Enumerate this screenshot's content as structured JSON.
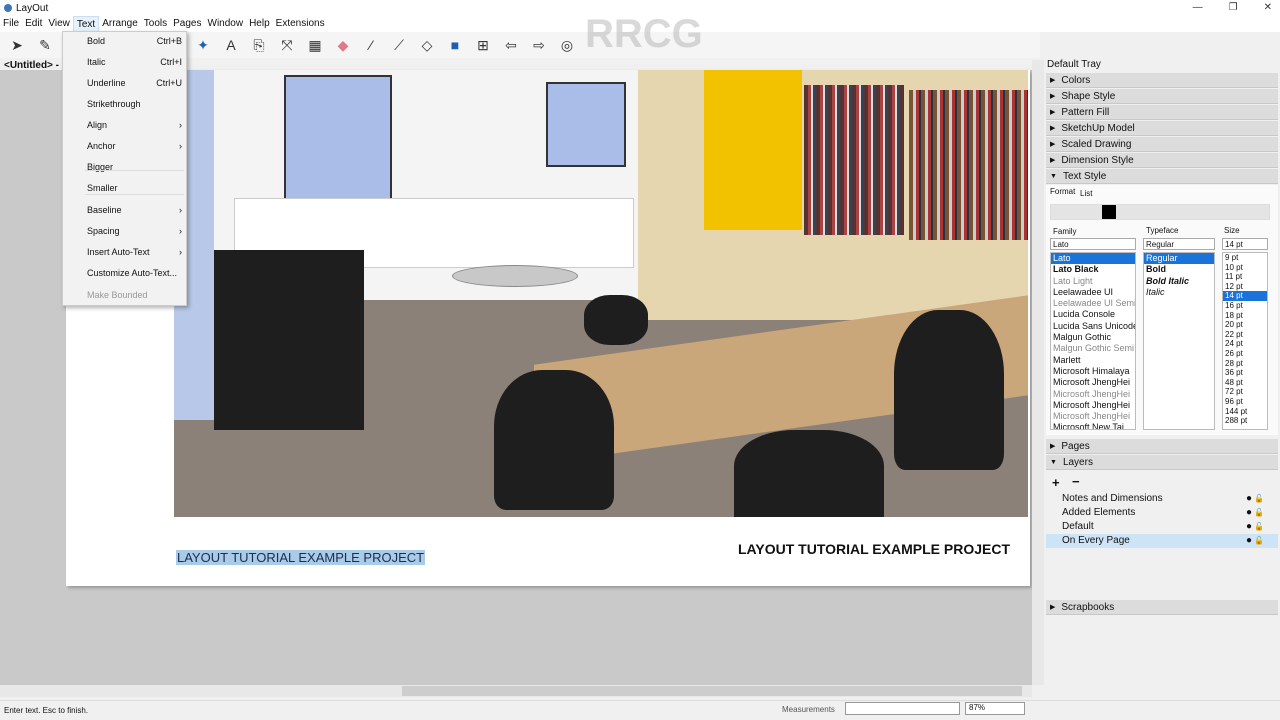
{
  "app": {
    "title": "LayOut",
    "doc_tab": "<Untitled> -"
  },
  "menubar": [
    "File",
    "Edit",
    "View",
    "Text",
    "Arrange",
    "Tools",
    "Pages",
    "Window",
    "Help",
    "Extensions"
  ],
  "text_menu": [
    {
      "label": "Bold",
      "shortcut": "Ctrl+B"
    },
    {
      "label": "Italic",
      "shortcut": "Ctrl+I"
    },
    {
      "label": "Underline",
      "shortcut": "Ctrl+U"
    },
    {
      "label": "Strikethrough",
      "shortcut": ""
    },
    {
      "label": "Align",
      "shortcut": "›"
    },
    {
      "label": "Anchor",
      "shortcut": "›"
    },
    {
      "label": "Bigger",
      "shortcut": ""
    },
    {
      "label": "Smaller",
      "shortcut": ""
    },
    {
      "label": "Baseline",
      "shortcut": "›"
    },
    {
      "label": "Spacing",
      "shortcut": "›"
    },
    {
      "label": "Insert Auto-Text",
      "shortcut": "›"
    },
    {
      "label": "Customize Auto-Text...",
      "shortcut": ""
    },
    {
      "label": "Make Bounded",
      "shortcut": ""
    }
  ],
  "page": {
    "caption_selected": "LAYOUT TUTORIAL EXAMPLE PROJECT",
    "caption_title": "LAYOUT TUTORIAL EXAMPLE PROJECT"
  },
  "status": {
    "hint": "Enter text. Esc to finish.",
    "measurements_label": "Measurements",
    "zoom": "87%"
  },
  "tray": {
    "title": "Default Tray",
    "sections_top": [
      "Colors",
      "Shape Style",
      "Pattern Fill",
      "SketchUp Model",
      "Scaled Drawing",
      "Dimension Style",
      "Text Style"
    ],
    "text_style": {
      "tabs": [
        "Format",
        "List"
      ],
      "family_label": "Family",
      "typeface_label": "Typeface",
      "size_label": "Size",
      "family_value": "Lato",
      "typeface_value": "Regular",
      "size_value": "14 pt",
      "families": [
        "Lato",
        "Lato Black",
        "Lato Light",
        "Leelawadee UI",
        "Leelawadee UI Semi",
        "Lucida Console",
        "Lucida Sans Unicode",
        "Malgun Gothic",
        "Malgun Gothic Semi",
        "Marlett",
        "Microsoft Himalaya",
        "Microsoft JhengHei",
        "Microsoft JhengHei",
        "Microsoft JhengHei",
        "Microsoft JhengHei",
        "Microsoft New Tai"
      ],
      "typefaces": [
        "Regular",
        "Bold",
        "Bold Italic",
        "Italic"
      ],
      "sizes": [
        "9 pt",
        "10 pt",
        "11 pt",
        "12 pt",
        "14 pt",
        "16 pt",
        "18 pt",
        "20 pt",
        "22 pt",
        "24 pt",
        "26 pt",
        "28 pt",
        "36 pt",
        "48 pt",
        "72 pt",
        "96 pt",
        "144 pt",
        "288 pt"
      ]
    },
    "pages_label": "Pages",
    "layers_label": "Layers",
    "layers": [
      "Notes and Dimensions",
      "Added Elements",
      "Default",
      "On Every Page"
    ],
    "scrapbooks_label": "Scrapbooks"
  },
  "watermark": "RRCG"
}
